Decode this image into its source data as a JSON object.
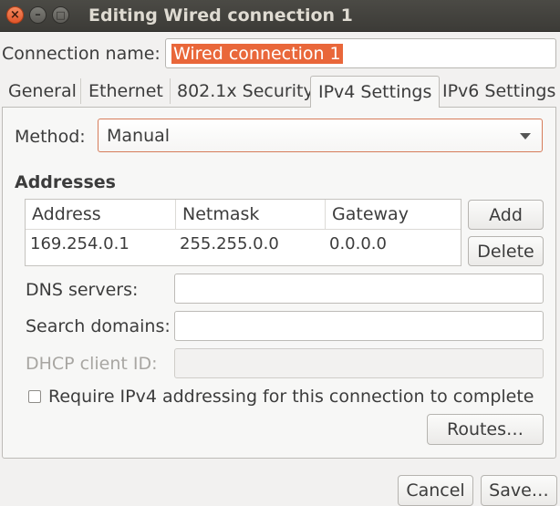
{
  "window": {
    "title": "Editing Wired connection 1",
    "close_symbol": "×",
    "minimize_symbol": "–",
    "maximize_symbol": "□"
  },
  "connection": {
    "label": "Connection name:",
    "value": "Wired connection 1"
  },
  "tabs": [
    {
      "label": "General",
      "active": false
    },
    {
      "label": "Ethernet",
      "active": false
    },
    {
      "label": "802.1x Security",
      "active": false
    },
    {
      "label": "IPv4 Settings",
      "active": true
    },
    {
      "label": "IPv6 Settings",
      "active": false
    }
  ],
  "method": {
    "label": "Method:",
    "value": "Manual"
  },
  "addresses": {
    "title": "Addresses",
    "columns": [
      "Address",
      "Netmask",
      "Gateway"
    ],
    "rows": [
      [
        "169.254.0.1",
        "255.255.0.0",
        "0.0.0.0"
      ]
    ],
    "add_label": "Add",
    "delete_label": "Delete"
  },
  "dns": {
    "label": "DNS servers:",
    "value": ""
  },
  "search_domains": {
    "label": "Search domains:",
    "value": ""
  },
  "dhcp_client_id": {
    "label": "DHCP client ID:",
    "value": "",
    "disabled": true
  },
  "require_ipv4": {
    "label": "Require IPv4 addressing for this connection to complete",
    "checked": false
  },
  "routes_label": "Routes…",
  "footer": {
    "cancel_label": "Cancel",
    "save_label": "Save…"
  },
  "colors": {
    "titlebar": "#3c3b37",
    "accent": "#e9673a"
  }
}
